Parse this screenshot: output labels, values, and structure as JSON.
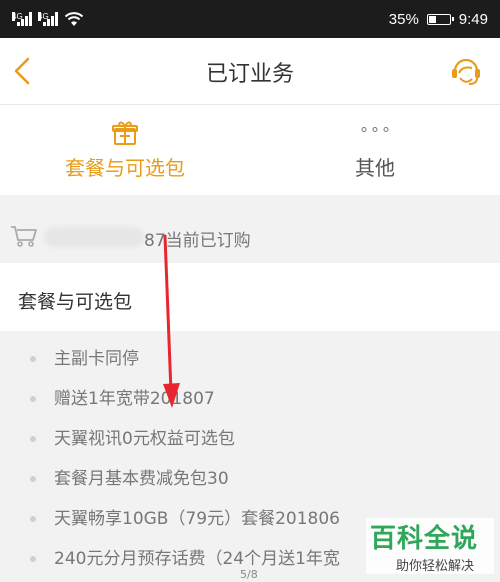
{
  "status_bar": {
    "signal1_label": "4G",
    "signal2_label": "4G",
    "battery_text": "35%",
    "time": "9:49"
  },
  "nav": {
    "title": "已订业务",
    "back_icon": "chevron-left-icon",
    "service_icon": "customer-service-icon"
  },
  "tabs": [
    {
      "label": "套餐与可选包",
      "icon": "gift-box-icon",
      "active": true
    },
    {
      "label": "其他",
      "icon": "more-dots-icon",
      "active": false
    }
  ],
  "subscribed": {
    "text": "87当前已订购",
    "icon": "cart-icon"
  },
  "section": {
    "title": "套餐与可选包"
  },
  "packages": [
    "主副卡同停",
    "赠送1年宽带201807",
    "天翼视讯0元权益可选包",
    "套餐月基本费减免包30",
    "天翼畅享10GB（79元）套餐201806",
    "240元分月预存话费（24个月送1年宽"
  ],
  "page_indicator": "5/8",
  "watermark": {
    "title": "百科全说",
    "subtitle": "助你轻松解决"
  },
  "colors": {
    "accent": "#e99c17",
    "status_bar": "#1c1c1c",
    "annotation_arrow": "#e8262f",
    "watermark_green": "#2fa65a"
  }
}
